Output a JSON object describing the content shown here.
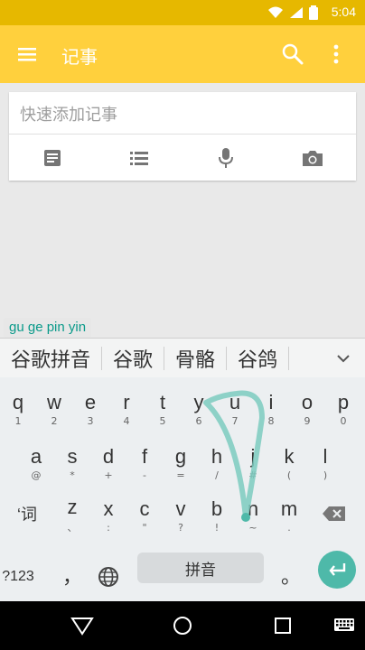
{
  "status": {
    "time": "5:04"
  },
  "appbar": {
    "title": "记事",
    "color": "#ffd03d"
  },
  "note": {
    "placeholder": "快速添加记事",
    "tools": [
      {
        "icon": "document-icon"
      },
      {
        "icon": "list-icon"
      },
      {
        "icon": "microphone-icon"
      },
      {
        "icon": "camera-icon"
      }
    ]
  },
  "ime": {
    "pinyin_preview": "gu ge pin yin",
    "candidates": [
      "谷歌拼音",
      "谷歌",
      "骨骼",
      "谷鸽"
    ],
    "rows": [
      [
        {
          "k": "q",
          "s": "1"
        },
        {
          "k": "w",
          "s": "2"
        },
        {
          "k": "e",
          "s": "3"
        },
        {
          "k": "r",
          "s": "4"
        },
        {
          "k": "t",
          "s": "5"
        },
        {
          "k": "y",
          "s": "6"
        },
        {
          "k": "u",
          "s": "7"
        },
        {
          "k": "i",
          "s": "8"
        },
        {
          "k": "o",
          "s": "9"
        },
        {
          "k": "p",
          "s": "0"
        }
      ],
      [
        {
          "k": "a",
          "s": "@"
        },
        {
          "k": "s",
          "s": "*"
        },
        {
          "k": "d",
          "s": "+"
        },
        {
          "k": "f",
          "s": "-"
        },
        {
          "k": "g",
          "s": "="
        },
        {
          "k": "h",
          "s": "/"
        },
        {
          "k": "j",
          "s": "#"
        },
        {
          "k": "k",
          "s": "("
        },
        {
          "k": "l",
          "s": ")"
        }
      ],
      [
        {
          "k": "‘词",
          "s": ""
        },
        {
          "k": "z",
          "s": "、"
        },
        {
          "k": "x",
          "s": ":"
        },
        {
          "k": "c",
          "s": "\""
        },
        {
          "k": "v",
          "s": "?"
        },
        {
          "k": "b",
          "s": "!"
        },
        {
          "k": "n",
          "s": "~"
        },
        {
          "k": "m",
          "s": "."
        }
      ]
    ],
    "bottom": {
      "symbols": "?123",
      "comma": "，",
      "space_label": "拼音",
      "period": "。"
    },
    "accent": "#4eb9a9"
  }
}
